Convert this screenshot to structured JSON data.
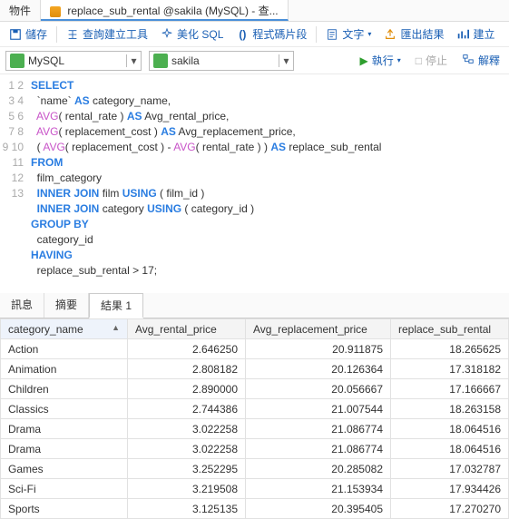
{
  "tabs": {
    "objects": "物件",
    "query": "replace_sub_rental @sakila (MySQL) - 查..."
  },
  "toolbar1": {
    "save": "儲存",
    "query_builder": "查詢建立工具",
    "beautify": "美化 SQL",
    "snippet": "程式碼片段",
    "text": "文字",
    "export": "匯出結果",
    "create": "建立"
  },
  "selectors": {
    "conn": "MySQL",
    "db": "sakila"
  },
  "runbar": {
    "run": "執行",
    "stop": "停止",
    "explain": "解釋"
  },
  "sql": {
    "l1": "SELECT",
    "l2a": "  `name` ",
    "l2b": "AS",
    "l2c": " category_name,",
    "l3a": "  AVG",
    "l3b": "( rental_rate ) ",
    "l3c": "AS",
    "l3d": " Avg_rental_price,",
    "l4a": "  AVG",
    "l4b": "( replacement_cost ) ",
    "l4c": "AS",
    "l4d": " Avg_replacement_price,",
    "l5a": "  ( ",
    "l5b": "AVG",
    "l5c": "( replacement_cost ) - ",
    "l5d": "AVG",
    "l5e": "( rental_rate ) ) ",
    "l5f": "AS",
    "l5g": " replace_sub_rental ",
    "l6": "FROM",
    "l7": "  film_category",
    "l8a": "  INNER JOIN",
    "l8b": " film ",
    "l8c": "USING",
    "l8d": " ( film_id )",
    "l9a": "  INNER JOIN",
    "l9b": " category ",
    "l9c": "USING",
    "l9d": " ( category_id )",
    "l10": "GROUP BY",
    "l11": "  category_id",
    "l12": "HAVING",
    "l13": "  replace_sub_rental > 17;"
  },
  "result_tabs": {
    "msg": "訊息",
    "summary": "摘要",
    "r1": "結果 1"
  },
  "grid": {
    "headers": {
      "c1": "category_name",
      "c2": "Avg_rental_price",
      "c3": "Avg_replacement_price",
      "c4": "replace_sub_rental"
    },
    "rows": [
      {
        "c1": "Action",
        "c2": "2.646250",
        "c3": "20.911875",
        "c4": "18.265625"
      },
      {
        "c1": "Animation",
        "c2": "2.808182",
        "c3": "20.126364",
        "c4": "17.318182"
      },
      {
        "c1": "Children",
        "c2": "2.890000",
        "c3": "20.056667",
        "c4": "17.166667"
      },
      {
        "c1": "Classics",
        "c2": "2.744386",
        "c3": "21.007544",
        "c4": "18.263158"
      },
      {
        "c1": "Drama",
        "c2": "3.022258",
        "c3": "21.086774",
        "c4": "18.064516"
      },
      {
        "c1": "Drama",
        "c2": "3.022258",
        "c3": "21.086774",
        "c4": "18.064516"
      },
      {
        "c1": "Games",
        "c2": "3.252295",
        "c3": "20.285082",
        "c4": "17.032787"
      },
      {
        "c1": "Sci-Fi",
        "c2": "3.219508",
        "c3": "21.153934",
        "c4": "17.934426"
      },
      {
        "c1": "Sports",
        "c2": "3.125135",
        "c3": "20.395405",
        "c4": "17.270270"
      }
    ]
  },
  "chart_data": {
    "type": "table",
    "title": "結果 1",
    "columns": [
      "category_name",
      "Avg_rental_price",
      "Avg_replacement_price",
      "replace_sub_rental"
    ],
    "rows": [
      [
        "Action",
        2.64625,
        20.911875,
        18.265625
      ],
      [
        "Animation",
        2.808182,
        20.126364,
        17.318182
      ],
      [
        "Children",
        2.89,
        20.056667,
        17.166667
      ],
      [
        "Classics",
        2.744386,
        21.007544,
        18.263158
      ],
      [
        "Drama",
        3.022258,
        21.086774,
        18.064516
      ],
      [
        "Drama",
        3.022258,
        21.086774,
        18.064516
      ],
      [
        "Games",
        3.252295,
        20.285082,
        17.032787
      ],
      [
        "Sci-Fi",
        3.219508,
        21.153934,
        17.934426
      ],
      [
        "Sports",
        3.125135,
        20.395405,
        17.27027
      ]
    ]
  }
}
